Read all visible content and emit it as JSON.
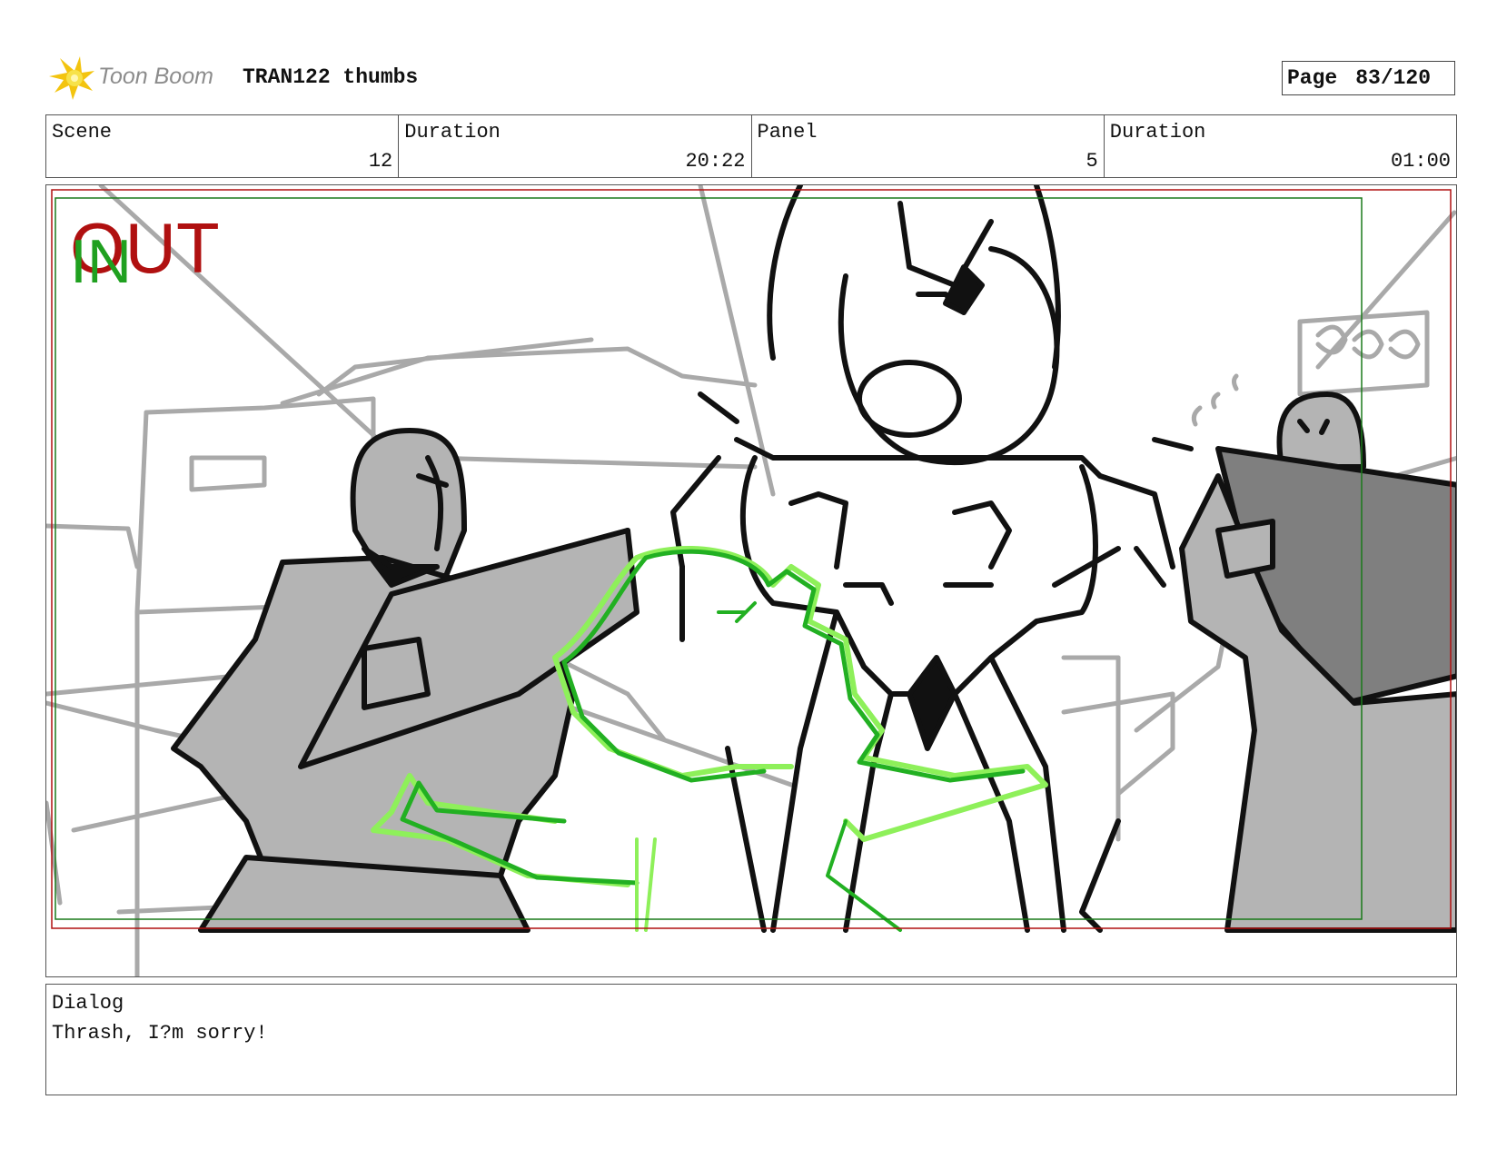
{
  "header": {
    "brand": "Toon Boom",
    "project_title": "TRAN122 thumbs",
    "page_label": "Page",
    "page_number": "83/120"
  },
  "info": {
    "scene_label": "Scene",
    "scene_value": "12",
    "scene_duration_label": "Duration",
    "scene_duration_value": "20:22",
    "panel_label": "Panel",
    "panel_value": "5",
    "panel_duration_label": "Duration",
    "panel_duration_value": "01:00"
  },
  "panel": {
    "out_marker": "OUT",
    "in_marker": "IN",
    "colors": {
      "out": "#b01010",
      "in": "#1fa01f",
      "sketch_black": "#111111",
      "sketch_gray": "#a9a9a9",
      "energy_green": "#22b022",
      "energy_lime": "#8ef05a"
    }
  },
  "dialog": {
    "label": "Dialog",
    "text": "Thrash, I?m sorry!"
  }
}
